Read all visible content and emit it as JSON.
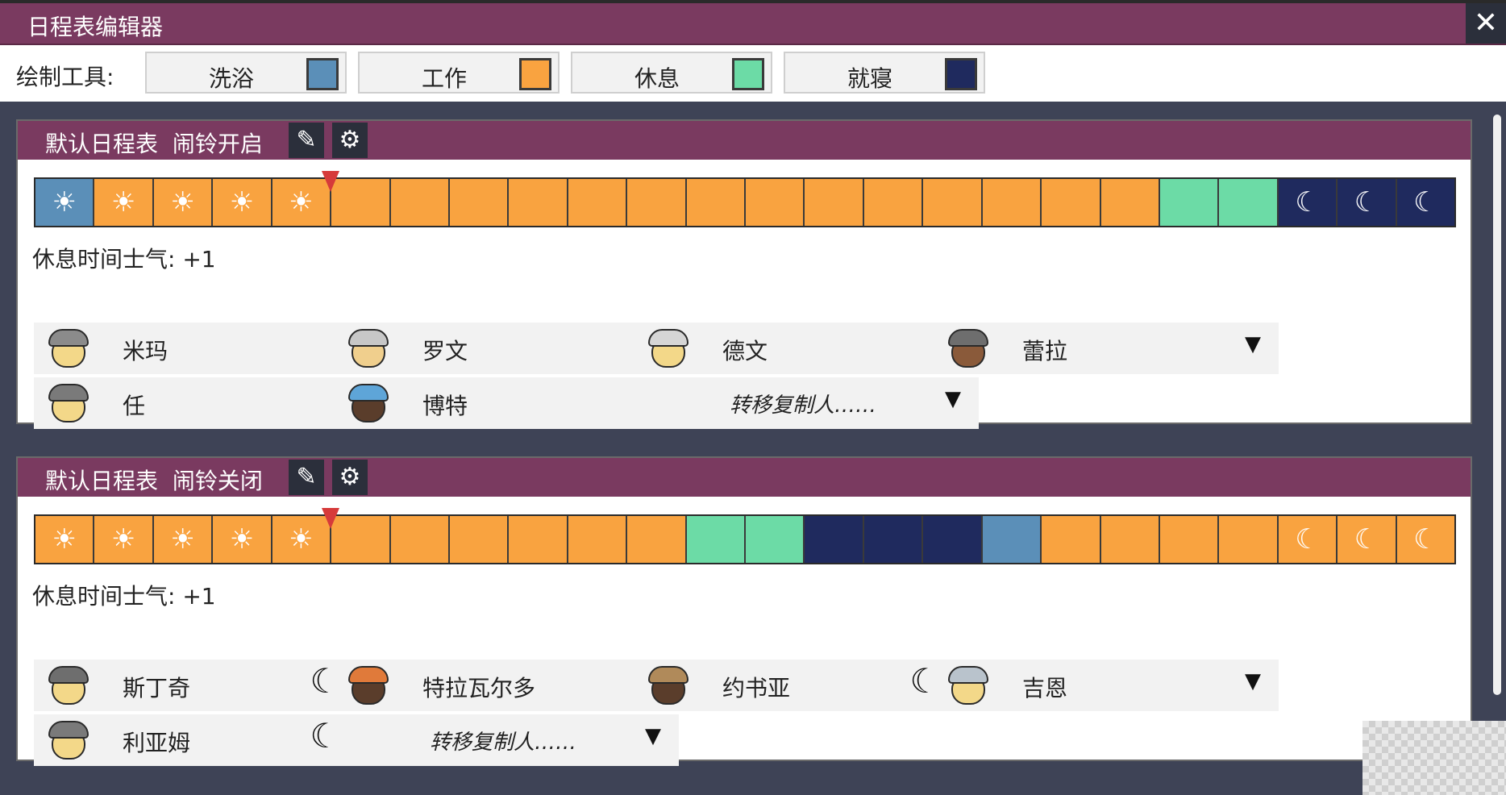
{
  "window": {
    "title": "日程表编辑器",
    "close_icon": "✕"
  },
  "toolbar": {
    "label": "绘制工具:",
    "tools": [
      {
        "name": "洗浴",
        "color": "#5b8fb8"
      },
      {
        "name": "工作",
        "color": "#f9a340"
      },
      {
        "name": "休息",
        "color": "#6cdba6"
      },
      {
        "name": "就寝",
        "color": "#1f2a5e"
      }
    ]
  },
  "colors": {
    "bath": "#5b8fb8",
    "work": "#f9a340",
    "rest": "#6cdba6",
    "sleep": "#1f2a5e",
    "header": "#7a3a60"
  },
  "schedules": [
    {
      "name": "默认日程表",
      "alarm": "闹铃开启",
      "edit_icon": "pencil-icon",
      "settings_icon": "gear-icon",
      "blocks": [
        "bath",
        "work",
        "work",
        "work",
        "work",
        "work",
        "work",
        "work",
        "work",
        "work",
        "work",
        "work",
        "work",
        "work",
        "work",
        "work",
        "work",
        "work",
        "work",
        "rest",
        "rest",
        "sleep",
        "sleep",
        "sleep"
      ],
      "sun_blocks": 5,
      "moon_blocks": 3,
      "marker_hour": 5,
      "morale": "休息时间士气: +1",
      "dupes": [
        {
          "name": "米玛",
          "hat": "#8b8b8b",
          "face": "#f3d889",
          "moon": false
        },
        {
          "name": "罗文",
          "hat": "#c7c7c7",
          "face": "#f0cf8d",
          "moon": false
        },
        {
          "name": "德文",
          "hat": "#d6d6d6",
          "face": "#f3d889",
          "moon": false
        },
        {
          "name": "蕾拉",
          "hat": "#6e6e6e",
          "face": "#8a5a3a",
          "moon": false
        },
        {
          "name": "任",
          "hat": "#7a7a7a",
          "face": "#f3d889",
          "moon": false
        },
        {
          "name": "博特",
          "hat": "#5ea5d8",
          "face": "#5a3d2b",
          "moon": false
        }
      ],
      "transfer": "转移复制人……"
    },
    {
      "name": "默认日程表",
      "alarm": "闹铃关闭",
      "edit_icon": "pencil-icon",
      "settings_icon": "gear-icon",
      "blocks": [
        "work",
        "work",
        "work",
        "work",
        "work",
        "work",
        "work",
        "work",
        "work",
        "work",
        "work",
        "rest",
        "rest",
        "sleep",
        "sleep",
        "sleep",
        "bath",
        "work",
        "work",
        "work",
        "work",
        "work",
        "work",
        "work"
      ],
      "sun_blocks": 5,
      "moon_blocks": 3,
      "marker_hour": 5,
      "morale": "休息时间士气: +1",
      "dupes": [
        {
          "name": "斯丁奇",
          "hat": "#6e6e6e",
          "face": "#f3d889",
          "moon": true
        },
        {
          "name": "特拉瓦尔多",
          "hat": "#e07a3a",
          "face": "#5a3d2b",
          "moon": false
        },
        {
          "name": "约书亚",
          "hat": "#b08a5a",
          "face": "#5a3d2b",
          "moon": true
        },
        {
          "name": "吉恩",
          "hat": "#b9c3cc",
          "face": "#f3d889",
          "moon": false
        },
        {
          "name": "利亚姆",
          "hat": "#7a7a7a",
          "face": "#f3d889",
          "moon": true
        }
      ],
      "transfer": "转移复制人……"
    }
  ]
}
